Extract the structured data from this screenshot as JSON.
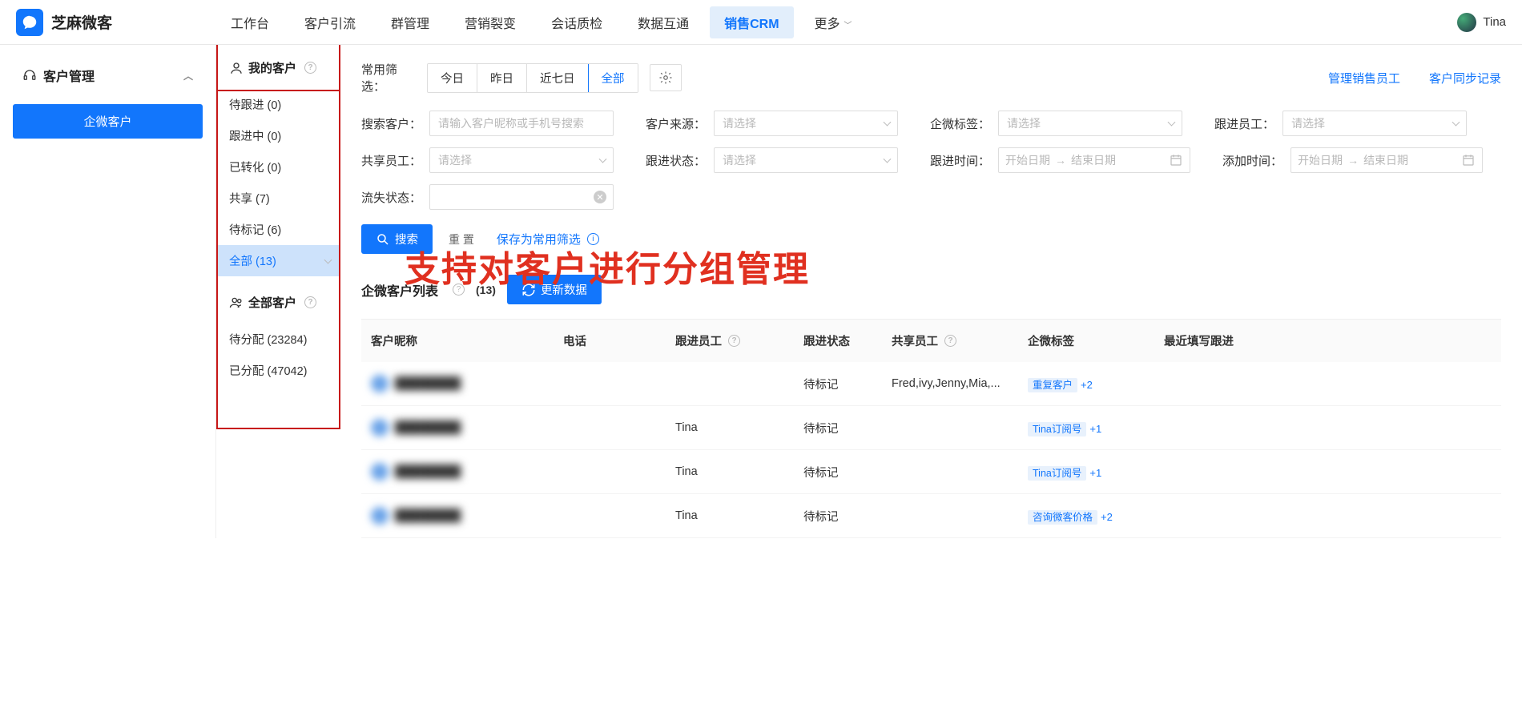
{
  "brand": "芝麻微客",
  "topnav": [
    "工作台",
    "客户引流",
    "群管理",
    "营销裂变",
    "会话质检",
    "数据互通",
    "销售CRM",
    "更多"
  ],
  "topnav_active": 6,
  "user_name": "Tina",
  "side": {
    "title": "客户管理",
    "button": "企微客户"
  },
  "secondary": {
    "head1": "我的客户",
    "items1": [
      {
        "label": "待跟进 (0)"
      },
      {
        "label": "跟进中 (0)"
      },
      {
        "label": "已转化 (0)"
      },
      {
        "label": "共享 (7)"
      },
      {
        "label": "待标记 (6)"
      },
      {
        "label": "全部 (13)",
        "sel": true
      }
    ],
    "head2": "全部客户",
    "items2": [
      {
        "label": "待分配 (23284)"
      },
      {
        "label": "已分配 (47042)"
      }
    ]
  },
  "quickfilter": {
    "label": "常用筛选：",
    "opts": [
      "今日",
      "昨日",
      "近七日",
      "全部"
    ],
    "active": 3
  },
  "toplinks": [
    "管理销售员工",
    "客户同步记录"
  ],
  "filters": {
    "search_customer": {
      "label": "搜索客户：",
      "ph": "请输入客户昵称或手机号搜索"
    },
    "source": {
      "label": "客户来源：",
      "ph": "请选择"
    },
    "wxtag": {
      "label": "企微标签：",
      "ph": "请选择"
    },
    "follow_staff": {
      "label": "跟进员工：",
      "ph": "请选择"
    },
    "share_staff": {
      "label": "共享员工：",
      "ph": "请选择"
    },
    "follow_status": {
      "label": "跟进状态：",
      "ph": "请选择"
    },
    "follow_time": {
      "label": "跟进时间：",
      "start": "开始日期",
      "end": "结束日期"
    },
    "add_time": {
      "label": "添加时间：",
      "start": "开始日期",
      "end": "结束日期"
    },
    "lost_status": {
      "label": "流失状态："
    }
  },
  "buttons": {
    "search": "搜索",
    "reset": "重 置",
    "save_filter": "保存为常用筛选",
    "update": "更新数据"
  },
  "overlay": "支持对客户进行分组管理",
  "list": {
    "title": "企微客户列表",
    "count": "(13)"
  },
  "columns": [
    "客户昵称",
    "电话",
    "跟进员工",
    "跟进状态",
    "共享员工",
    "企微标签",
    "最近填写跟进"
  ],
  "rows": [
    {
      "name": "████████",
      "phone": "",
      "staff": "",
      "status": "待标记",
      "share": "Fred,ivy,Jenny,Mia,...",
      "tag": "重复客户",
      "extra": "+2"
    },
    {
      "name": "████████",
      "phone": "",
      "staff": "Tina",
      "status": "待标记",
      "share": "",
      "tag": "Tina订阅号",
      "extra": "+1"
    },
    {
      "name": "████████",
      "phone": "",
      "staff": "Tina",
      "status": "待标记",
      "share": "",
      "tag": "Tina订阅号",
      "extra": "+1"
    },
    {
      "name": "████████",
      "phone": "",
      "staff": "Tina",
      "status": "待标记",
      "share": "",
      "tag": "咨询微客价格",
      "extra": "+2"
    }
  ]
}
